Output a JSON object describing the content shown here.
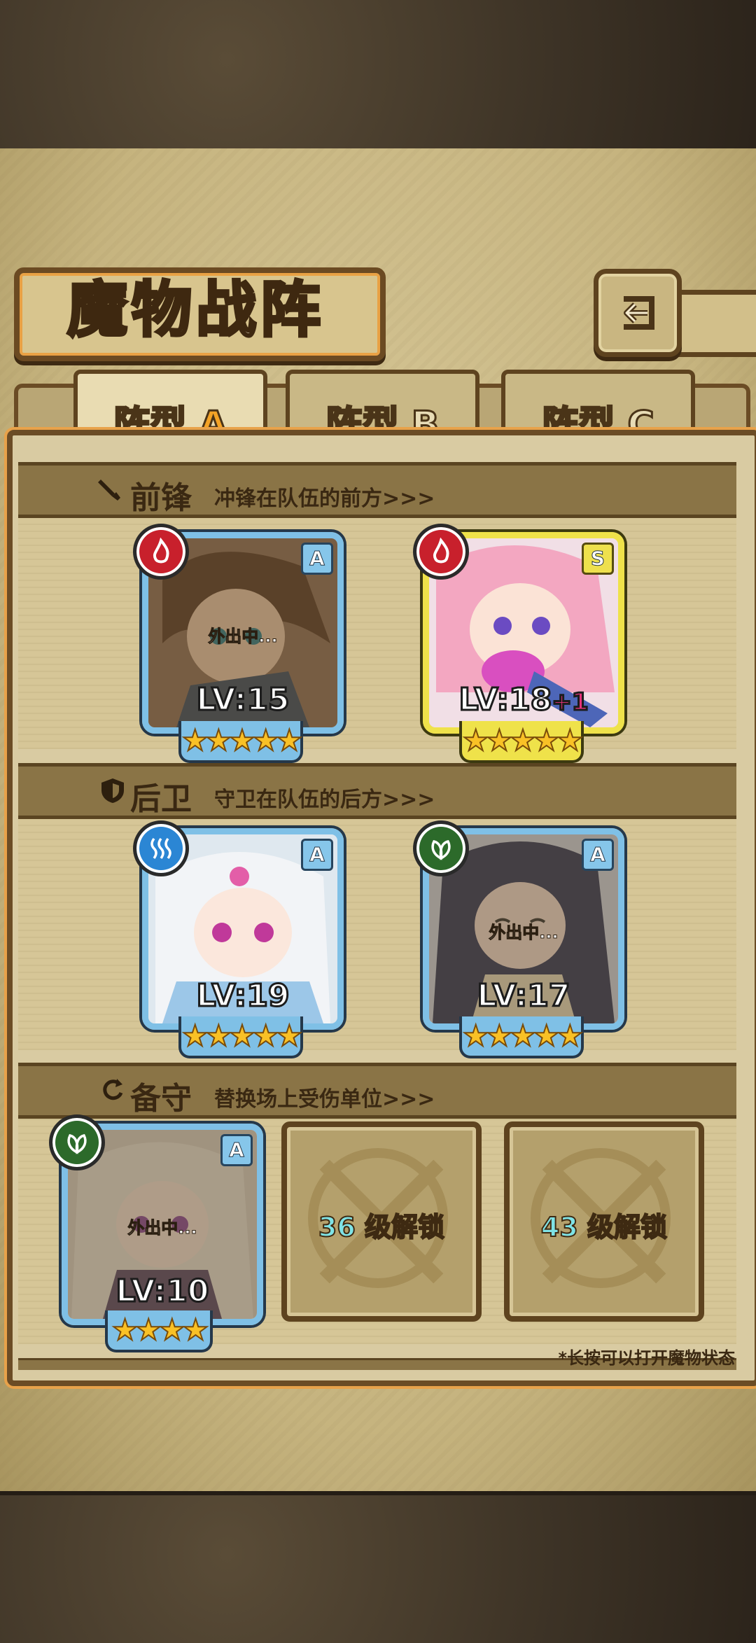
{
  "header": {
    "title": "魔物战阵",
    "back_icon": "return-arrow-icon"
  },
  "tabs": [
    {
      "label": "阵型",
      "suffix": "A",
      "active": true
    },
    {
      "label": "阵型",
      "suffix": "B",
      "active": false
    },
    {
      "label": "阵型",
      "suffix": "C",
      "active": false
    }
  ],
  "sections": {
    "front": {
      "title": "前锋",
      "subtitle": "冲锋在队伍的前方>>>"
    },
    "rear": {
      "title": "后卫",
      "subtitle": "守卫在队伍的后方>>>"
    },
    "reserve": {
      "title": "备守",
      "subtitle": "替换场上受伤单位>>>"
    }
  },
  "cards": {
    "front1": {
      "level": "LV:15",
      "bonus": "",
      "rank": "A",
      "element": "fire",
      "status": "外出中...",
      "stars": "★★★★★"
    },
    "front2": {
      "level": "LV:18",
      "bonus": "+1",
      "rank": "S",
      "element": "fire",
      "status": "",
      "stars": "★★★★★"
    },
    "rear1": {
      "level": "LV:19",
      "bonus": "",
      "rank": "A",
      "element": "water",
      "status": "",
      "stars": "★★★★★"
    },
    "rear2": {
      "level": "LV:17",
      "bonus": "",
      "rank": "A",
      "element": "leaf",
      "status": "外出中...",
      "stars": "★★★★★"
    },
    "reserve1": {
      "level": "LV:10",
      "bonus": "",
      "rank": "A",
      "element": "leaf",
      "status": "外出中...",
      "stars": "★★★★"
    }
  },
  "locked_slots": [
    {
      "num": "36",
      "text": "级解锁"
    },
    {
      "num": "43",
      "text": "级解锁"
    }
  ],
  "hint": "*长按可以打开魔物状态",
  "colors": {
    "fire": "#c8202c",
    "water": "#2b86d4",
    "leaf": "#2c6a2a",
    "accent": "#f4a326"
  }
}
